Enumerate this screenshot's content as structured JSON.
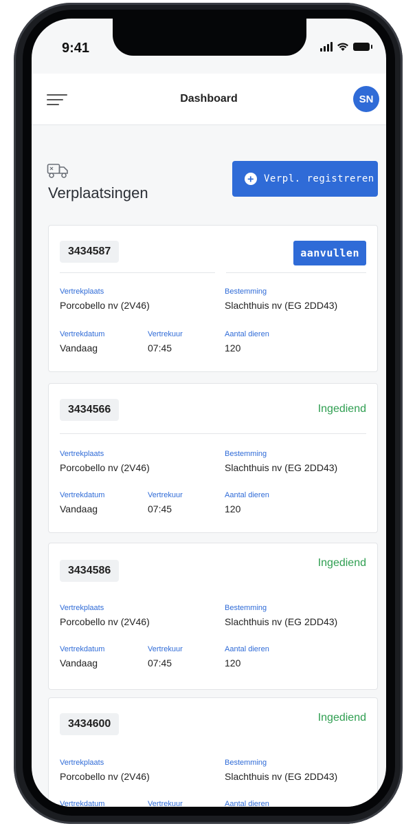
{
  "status_bar": {
    "time": "9:41"
  },
  "header": {
    "title": "Dashboard",
    "avatar_initials": "SN"
  },
  "page": {
    "title": "Verplaatsingen",
    "register_button": "Verpl. registreren"
  },
  "colors": {
    "accent": "#2f6bd7",
    "success": "#2e9e50",
    "label": "#2f6bd7"
  },
  "cards": [
    {
      "id": "3434587",
      "action": "aanvullen",
      "status": "",
      "vertrekplaats_label": "Vertrekplaats",
      "vertrekplaats": "Porcobello nv (2V46)",
      "bestemming_label": "Bestemming",
      "bestemming": "Slachthuis nv (EG 2DD43)",
      "vertrekdatum_label": "Vertrekdatum",
      "vertrekdatum": "Vandaag",
      "vertrekuur_label": "Vertrekuur",
      "vertrekuur": "07:45",
      "dieren_label": "Aantal dieren",
      "dieren": "120"
    },
    {
      "id": "3434566",
      "action": "",
      "status": "Ingediend",
      "vertrekplaats_label": "Vertrekplaats",
      "vertrekplaats": "Porcobello nv (2V46)",
      "bestemming_label": "Bestemming",
      "bestemming": "Slachthuis nv (EG 2DD43)",
      "vertrekdatum_label": "Vertrekdatum",
      "vertrekdatum": "Vandaag",
      "vertrekuur_label": "Vertrekuur",
      "vertrekuur": "07:45",
      "dieren_label": "Aantal dieren",
      "dieren": "120"
    },
    {
      "id": "3434586",
      "action": "",
      "status": "Ingediend",
      "vertrekplaats_label": "Vertrekplaats",
      "vertrekplaats": "Porcobello nv (2V46)",
      "bestemming_label": "Bestemming",
      "bestemming": "Slachthuis nv (EG 2DD43)",
      "vertrekdatum_label": "Vertrekdatum",
      "vertrekdatum": "Vandaag",
      "vertrekuur_label": "Vertrekuur",
      "vertrekuur": "07:45",
      "dieren_label": "Aantal dieren",
      "dieren": "120"
    },
    {
      "id": "3434600",
      "action": "",
      "status": "Ingediend",
      "vertrekplaats_label": "Vertrekplaats",
      "vertrekplaats": "Porcobello nv (2V46)",
      "bestemming_label": "Bestemming",
      "bestemming": "Slachthuis nv (EG 2DD43)",
      "vertrekdatum_label": "Vertrekdatum",
      "vertrekdatum": "",
      "vertrekuur_label": "Vertrekuur",
      "vertrekuur": "",
      "dieren_label": "Aantal dieren",
      "dieren": ""
    }
  ]
}
